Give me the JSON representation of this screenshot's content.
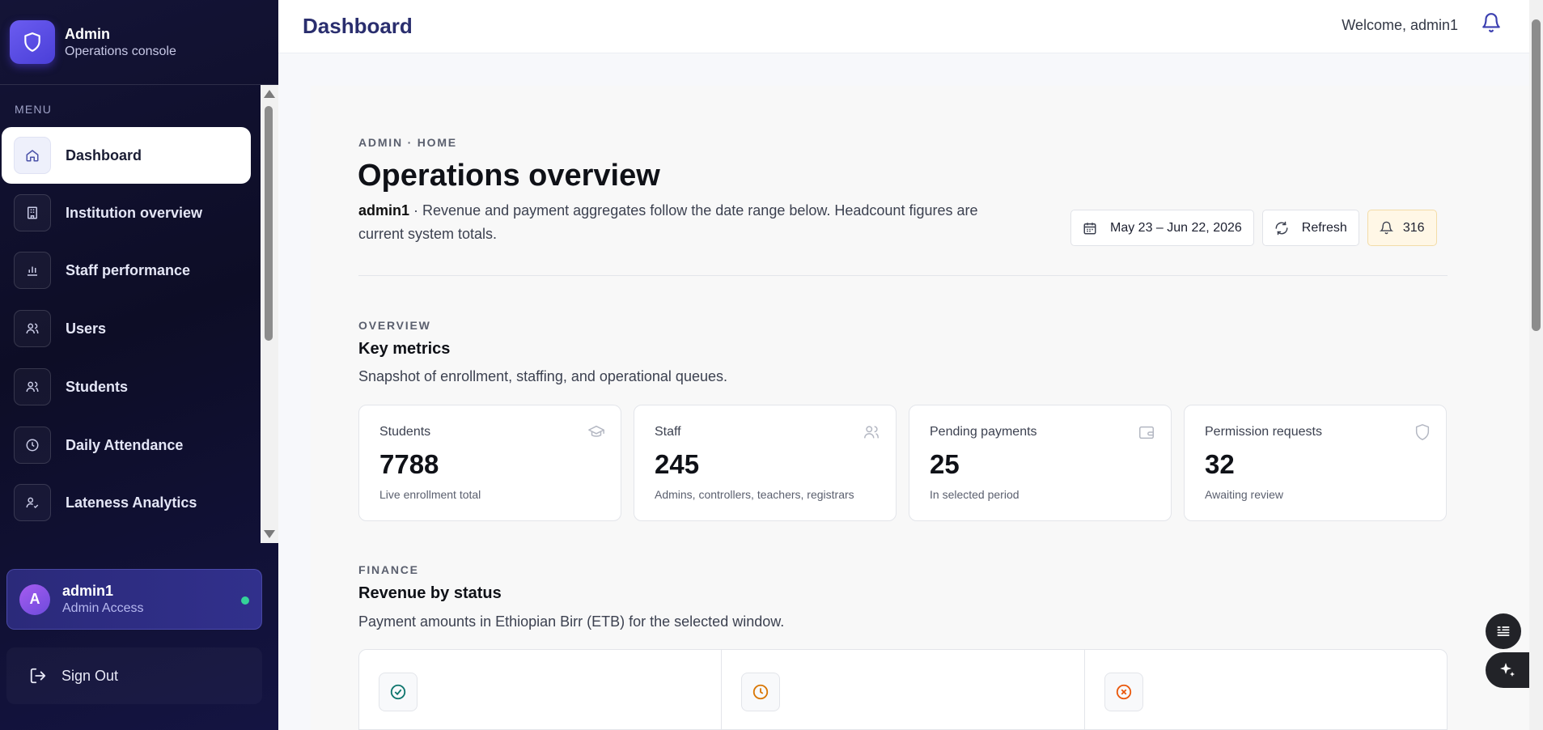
{
  "brand": {
    "title": "Admin",
    "subtitle": "Operations console"
  },
  "sidebar": {
    "menu_label": "MENU",
    "items": [
      {
        "label": "Dashboard",
        "icon": "home-icon",
        "active": true
      },
      {
        "label": "Institution overview",
        "icon": "building-icon"
      },
      {
        "label": "Staff performance",
        "icon": "bar-chart-icon"
      },
      {
        "label": "Users",
        "icon": "users-icon"
      },
      {
        "label": "Students",
        "icon": "users-icon"
      },
      {
        "label": "Daily Attendance",
        "icon": "clock-icon"
      },
      {
        "label": "Lateness Analytics",
        "icon": "user-check-icon"
      }
    ]
  },
  "user": {
    "initial": "A",
    "name": "admin1",
    "role": "Admin Access",
    "status_color": "#34d399"
  },
  "signout": {
    "label": "Sign Out"
  },
  "topbar": {
    "title": "Dashboard",
    "welcome": "Welcome, admin1"
  },
  "header": {
    "breadcrumb": "ADMIN · HOME",
    "title": "Operations overview",
    "user": "admin1",
    "description": " · Revenue and payment aggregates follow the date range below. Headcount figures are current system totals.",
    "date_range": "May 23 – Jun 22, 2026",
    "refresh_label": "Refresh",
    "notification_count": "316"
  },
  "overview": {
    "eyebrow": "OVERVIEW",
    "title": "Key metrics",
    "subtitle": "Snapshot of enrollment, staffing, and operational queues.",
    "metrics": [
      {
        "label": "Students",
        "value": "7788",
        "note": "Live enrollment total",
        "icon": "graduation-cap-icon"
      },
      {
        "label": "Staff",
        "value": "245",
        "note": "Admins, controllers, teachers, registrars",
        "icon": "users-icon"
      },
      {
        "label": "Pending payments",
        "value": "25",
        "note": "In selected period",
        "icon": "wallet-icon"
      },
      {
        "label": "Permission requests",
        "value": "32",
        "note": "Awaiting review",
        "icon": "shield-icon"
      }
    ]
  },
  "finance": {
    "eyebrow": "FINANCE",
    "title": "Revenue by status",
    "subtitle": "Payment amounts in Ethiopian Birr (ETB) for the selected window.",
    "status_icons": [
      "check-circle-icon",
      "clock-icon",
      "x-circle-icon"
    ],
    "colors": {
      "paid": "#0f766e",
      "pending": "#d97706",
      "failed": "#ea580c"
    }
  },
  "colors": {
    "accent": "#2a2e6e",
    "sidebar_bg": "#0d0d26",
    "brand_purple": "#5b4ee6"
  }
}
